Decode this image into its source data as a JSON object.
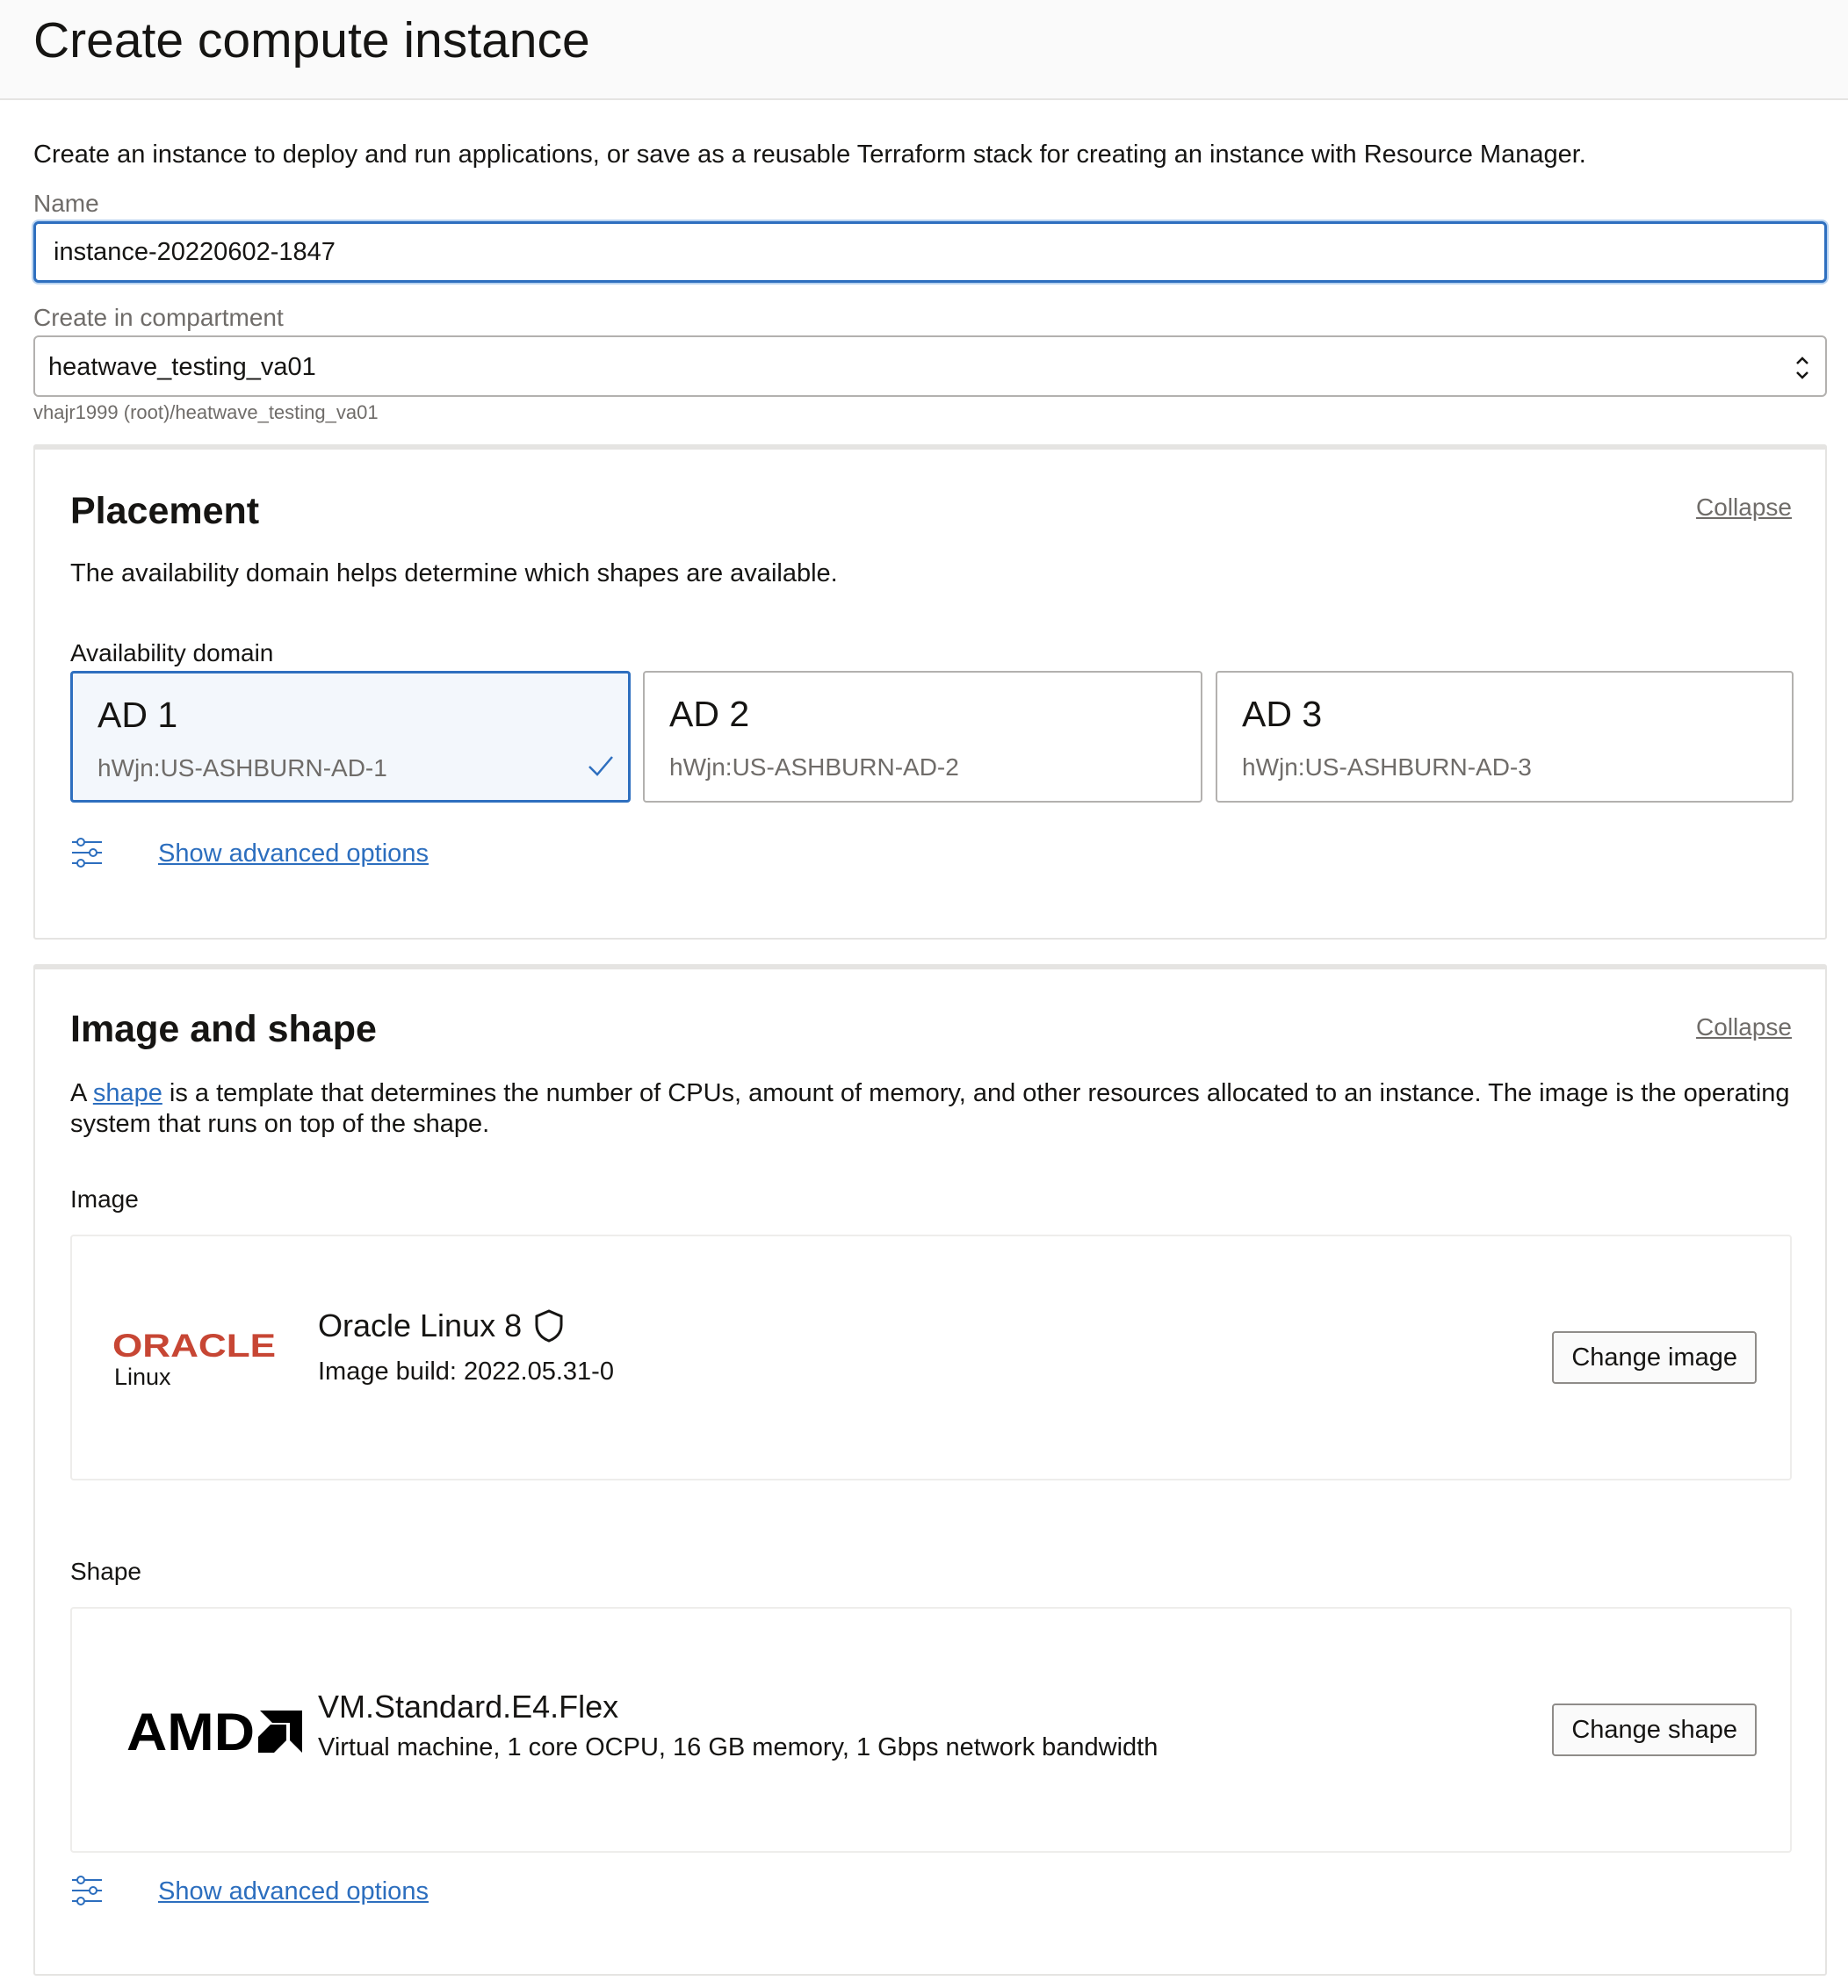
{
  "page": {
    "title": "Create compute instance",
    "intro": "Create an instance to deploy and run applications, or save as a reusable Terraform stack for creating an instance with Resource Manager."
  },
  "name_field": {
    "label": "Name",
    "value": "instance-20220602-1847"
  },
  "compartment": {
    "label": "Create in compartment",
    "value": "heatwave_testing_va01",
    "path": "vhajr1999 (root)/heatwave_testing_va01"
  },
  "placement": {
    "title": "Placement",
    "collapse": "Collapse",
    "description": "The availability domain helps determine which shapes are available.",
    "ad_label": "Availability domain",
    "domains": [
      {
        "name": "AD 1",
        "id": "hWjn:US-ASHBURN-AD-1",
        "selected": true
      },
      {
        "name": "AD 2",
        "id": "hWjn:US-ASHBURN-AD-2",
        "selected": false
      },
      {
        "name": "AD 3",
        "id": "hWjn:US-ASHBURN-AD-3",
        "selected": false
      }
    ],
    "advanced": "Show advanced options"
  },
  "image_shape": {
    "title": "Image and shape",
    "collapse": "Collapse",
    "desc_prefix": "A ",
    "desc_link": "shape",
    "desc_line1": " is a template that determines the number of CPUs, amount of memory, and other resources allocated to an instance. The image is the operating",
    "desc_line2": "system that runs on top of the shape.",
    "image_label": "Image",
    "image": {
      "logo_text": "ORACLE",
      "logo_sub": "Linux",
      "name": "Oracle Linux 8",
      "build": "Image build: 2022.05.31-0",
      "button": "Change image"
    },
    "shape_label": "Shape",
    "shape": {
      "logo_text": "AMD",
      "name": "VM.Standard.E4.Flex",
      "details": "Virtual machine, 1 core OCPU, 16 GB memory, 1 Gbps network bandwidth",
      "button": "Change shape"
    },
    "advanced": "Show advanced options"
  },
  "colors": {
    "accent": "#2e6fbf",
    "link": "#2c6ebe",
    "oracle_red": "#c74634",
    "muted": "#6f6c69"
  }
}
